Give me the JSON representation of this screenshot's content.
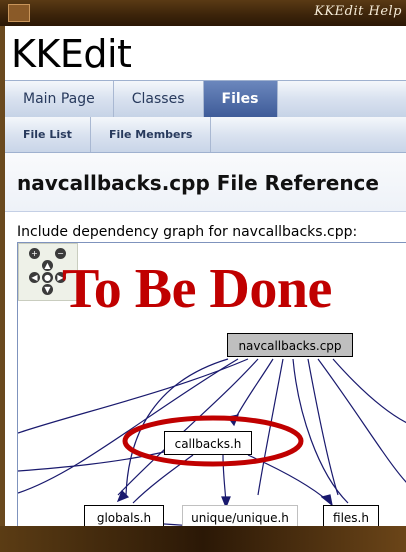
{
  "window": {
    "title": "KKEdit Help"
  },
  "project": {
    "title": "KKEdit"
  },
  "tabs": [
    {
      "label": "Main Page"
    },
    {
      "label": "Classes"
    },
    {
      "label": "Files",
      "active": true
    }
  ],
  "subtabs": [
    {
      "label": "File List"
    },
    {
      "label": "File Members"
    }
  ],
  "page": {
    "heading": "navcallbacks.cpp File Reference",
    "include_text": "Include dependency graph for navcallbacks.cpp:"
  },
  "graph": {
    "placeholder": "To Be Done",
    "nodes": {
      "root": "navcallbacks.cpp",
      "callbacks": "callbacks.h",
      "globals": "globals.h",
      "unique": "unique/unique.h",
      "files": "files.h"
    },
    "edge_color": "#1a1a6e",
    "annotation_color": "#c00000"
  }
}
